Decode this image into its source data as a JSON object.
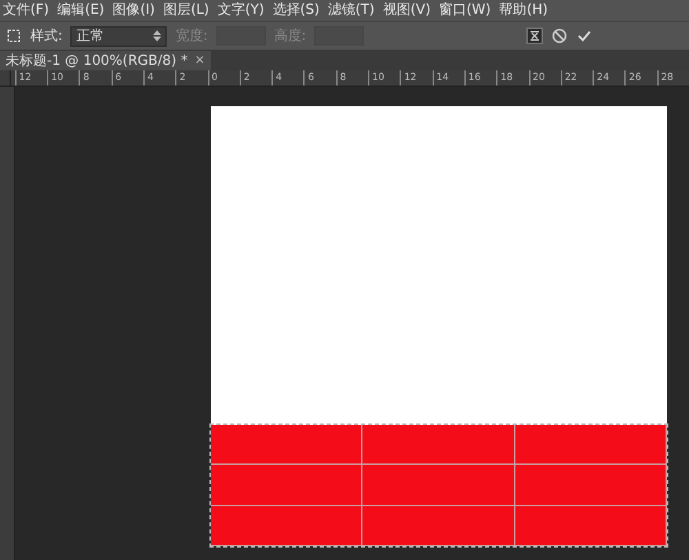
{
  "menu": [
    "文件(F)",
    "编辑(E)",
    "图像(I)",
    "图层(L)",
    "文字(Y)",
    "选择(S)",
    "滤镜(T)",
    "视图(V)",
    "窗口(W)",
    "帮助(H)"
  ],
  "options": {
    "style_label": "样式:",
    "style_value": "正常",
    "width_label": "宽度:",
    "height_label": "高度:",
    "size_disabled": true
  },
  "document_tab": {
    "title": "未标题-1 @ 100%(RGB/8) *",
    "close": "×"
  },
  "ruler": [
    "12",
    "10",
    "8",
    "6",
    "4",
    "2",
    "0",
    "2",
    "4",
    "6",
    "8",
    "10",
    "12",
    "14",
    "16",
    "18",
    "20",
    "22",
    "24",
    "26",
    "28"
  ]
}
